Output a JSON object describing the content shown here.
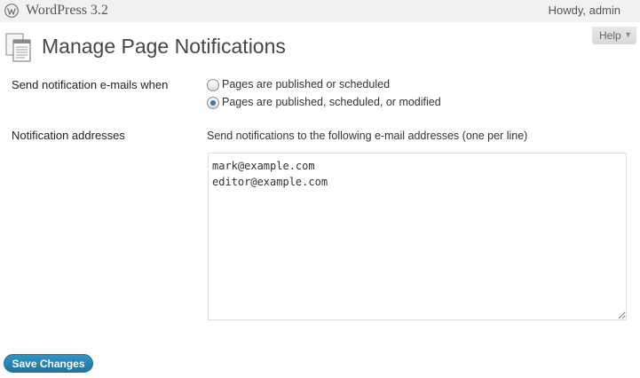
{
  "header": {
    "site_title": "WordPress 3.2",
    "user_greeting": "Howdy, admin",
    "logo_icon": "wordpress-logo-icon"
  },
  "help": {
    "label": "Help",
    "arrow": "▼"
  },
  "page": {
    "icon": "pages-icon",
    "title": "Manage Page Notifications"
  },
  "notify_when": {
    "label": "Send notification e-mails when",
    "options": [
      {
        "label": "Pages are published or scheduled",
        "selected": false
      },
      {
        "label": "Pages are published, scheduled, or modified",
        "selected": true
      }
    ]
  },
  "addresses": {
    "label": "Notification addresses",
    "description": "Send notifications to the following e-mail addresses (one per line)",
    "value": "mark@example.com\neditor@example.com"
  },
  "actions": {
    "save_label": "Save Changes"
  },
  "colors": {
    "accent": "#21759b",
    "radio_selected": "#3a6fb0",
    "header_bg": "#f1f1f1"
  }
}
